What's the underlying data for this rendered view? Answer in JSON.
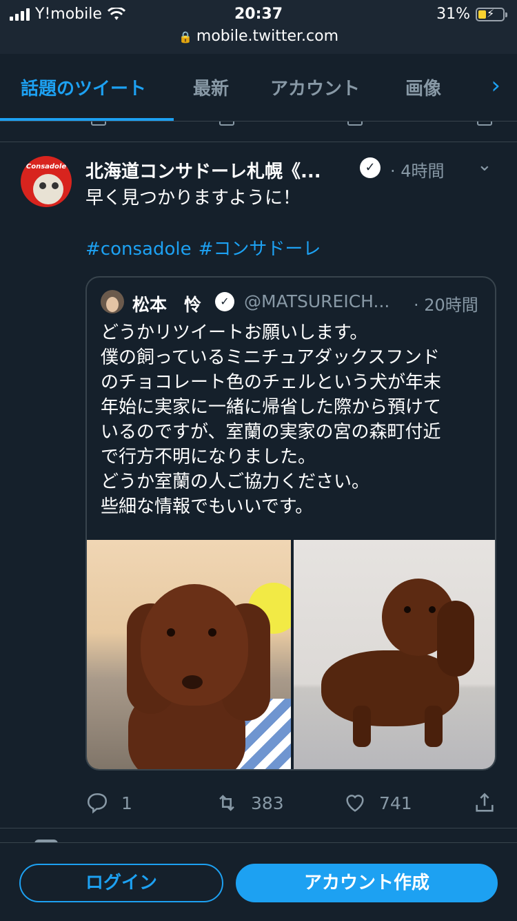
{
  "status_bar": {
    "carrier": "Y!mobile",
    "time": "20:37",
    "battery": "31%",
    "battery_level": 0.31,
    "url": "mobile.twitter.com"
  },
  "tabs": [
    {
      "label": "話題のツイート",
      "active": true
    },
    {
      "label": "最新",
      "active": false
    },
    {
      "label": "アカウント",
      "active": false
    },
    {
      "label": "画像",
      "active": false
    }
  ],
  "tweet": {
    "author_name": "北海道コンサドーレ札幌《...",
    "time": "· 4時間",
    "text": "早く見つかりますように！",
    "hashtags": [
      "#consadole",
      "#コンサドーレ"
    ],
    "avatar_logo_text": "Consadole",
    "quote": {
      "author_name": "松本　怜",
      "handle": "@MATSUREICH...",
      "time": "· 20時間",
      "lines": [
        "どうかリツイートお願いします。",
        "僕の飼っているミニチュアダックスフンド",
        "のチョコレート色のチェルという犬が年末",
        "年始に実家に一緒に帰省した際から預けて",
        "いるのですが、室蘭の実家の宮の森町付近",
        "で行方不明になりました。",
        "どうか室蘭の人ご協力ください。",
        "些細な情報でもいいです。"
      ]
    },
    "actions": {
      "reply_count": "1",
      "retweet_count": "383",
      "like_count": "741"
    }
  },
  "bottom_bar": {
    "login_label": "ログイン",
    "signup_label": "アカウント作成"
  },
  "colors": {
    "background": "#15202b",
    "accent": "#1da1f2",
    "secondary_text": "#8899a6",
    "border": "#38444d"
  },
  "icons": [
    "signal-icon",
    "wifi-icon",
    "lock-icon",
    "battery-icon",
    "chevron-right-icon",
    "verified-icon",
    "chevron-down-icon",
    "reply-icon",
    "retweet-icon",
    "like-icon",
    "share-icon"
  ]
}
